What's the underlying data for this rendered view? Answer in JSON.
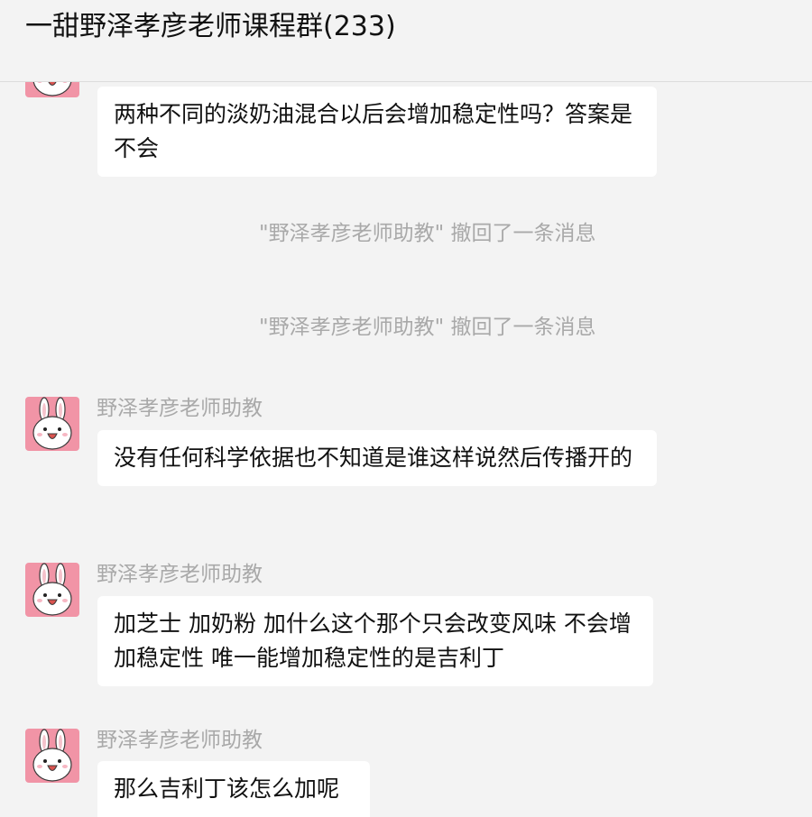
{
  "header": {
    "title": "一甜野泽孝彦老师课程群(233)"
  },
  "messages": [
    {
      "kind": "bubble",
      "sender": "",
      "text": "两种不同的淡奶油混合以后会增加稳定性吗？答案是不会"
    },
    {
      "kind": "system",
      "text": "\"野泽孝彦老师助教\" 撤回了一条消息"
    },
    {
      "kind": "system",
      "text": "\"野泽孝彦老师助教\" 撤回了一条消息"
    },
    {
      "kind": "bubble",
      "sender": "野泽孝彦老师助教",
      "text": "没有任何科学依据也不知道是谁这样说然后传播开的"
    },
    {
      "kind": "bubble",
      "sender": "野泽孝彦老师助教",
      "text": "加芝士 加奶粉 加什么这个那个只会改变风味 不会增加稳定性 唯一能增加稳定性的是吉利丁"
    },
    {
      "kind": "bubble",
      "sender": "野泽孝彦老师助教",
      "text": "那么吉利丁该怎么加呢"
    }
  ],
  "colors": {
    "background": "#f3f3f3",
    "bubble": "#ffffff",
    "avatar": "#f194a6",
    "muted_text": "#a9a9a9"
  },
  "icons": {
    "avatar": "bunny-avatar-icon"
  }
}
